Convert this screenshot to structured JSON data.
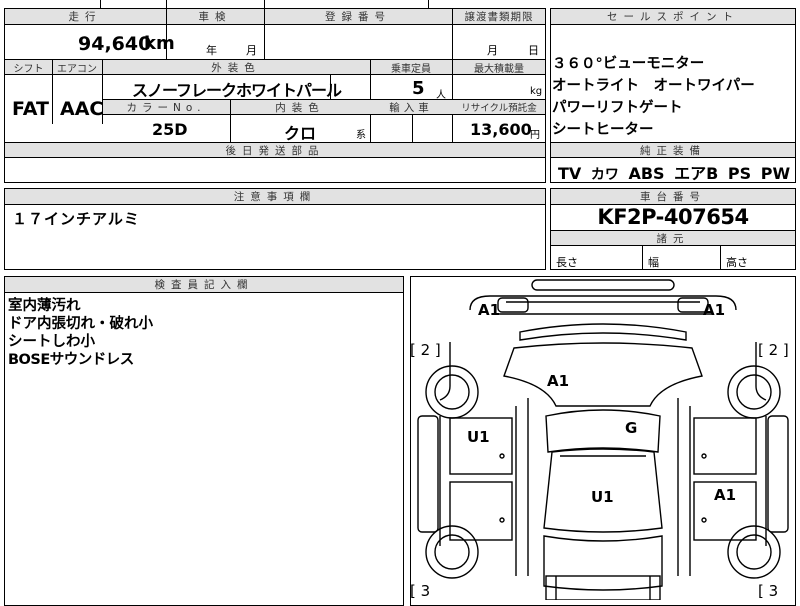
{
  "header": {
    "mileage_label": "走行",
    "inspection_label": "車検",
    "registration_label": "登録番号",
    "transfer_deadline_label": "譲渡書類期限",
    "selling_points_label": "セールスポイント"
  },
  "mileage": {
    "value": "94,640",
    "unit": "km"
  },
  "inspection": {
    "year_unit": "年",
    "month_unit": "月"
  },
  "transfer": {
    "month_unit": "月",
    "day_unit": "日"
  },
  "row2_labels": {
    "shift": "シフト",
    "aircon": "エアコン",
    "exterior_color": "外装色",
    "capacity": "乗車定員",
    "max_load": "最大積載量"
  },
  "shift_value": "FAT",
  "aircon_value": "AAC",
  "exterior_color_value": "スノーフレークホワイトパール",
  "capacity": {
    "value": "5",
    "unit": "人"
  },
  "max_load": {
    "unit": "kg"
  },
  "row3_labels": {
    "color_no": "カラーNo.",
    "interior_color": "内装色",
    "import": "輸入車",
    "recycle": "リサイクル預託金"
  },
  "color_no_value": "25D",
  "interior_color_value": "クロ",
  "interior_color_suffix": "系",
  "recycle": {
    "value": "13,600",
    "unit": "円"
  },
  "later_parts_label": "後日発送部品",
  "selling_points": [
    "３６０°ビューモニター",
    "オートライト　オートワイパー",
    "パワーリフトゲート",
    "シートヒーター"
  ],
  "equipment_label": "純正装備",
  "equipment": [
    "TV",
    "カワ",
    "ABS",
    "エアB",
    "PS",
    "PW"
  ],
  "notes_label": "注意事項欄",
  "notes_text": "１７インチアルミ",
  "chassis_label": "車台番号",
  "chassis_value": "KF2P-407654",
  "dimensions": {
    "label": "諸元",
    "length": "長さ",
    "width": "幅",
    "height": "高さ"
  },
  "inspector_label": "検査員記入欄",
  "inspector_notes": [
    "室内薄汚れ",
    "ドア内張切れ・破れ小",
    "シートしわ小",
    "BOSEサウンドレス"
  ],
  "damage_marks": {
    "front_left": "A1",
    "front_right": "A1",
    "hood": "A1",
    "left_front_door": "U1",
    "windshield": "G",
    "roof": "U1",
    "right_rear_door": "A1",
    "left_front_wheel": "[ 2 ]",
    "right_front_wheel": "[ 2 ]",
    "left_rear_wheel": "[ 3",
    "right_rear_wheel": "[ 3"
  }
}
